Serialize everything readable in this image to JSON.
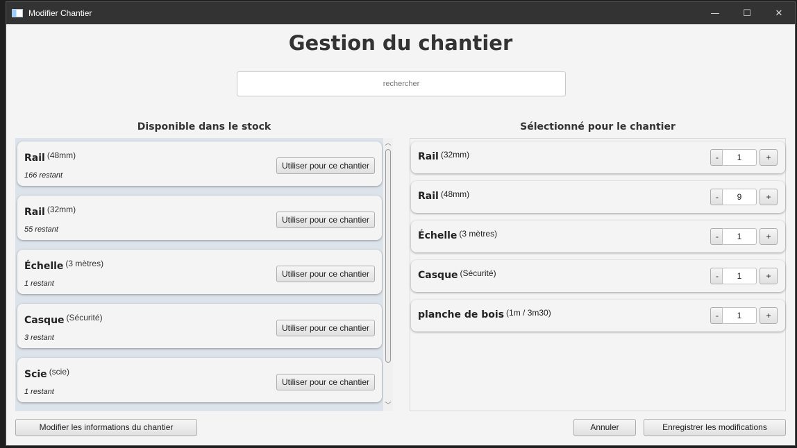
{
  "window": {
    "title": "Modifier Chantier",
    "controls": {
      "minimize": "—",
      "maximize": "☐",
      "close": "✕"
    }
  },
  "page_title": "Gestion du chantier",
  "search": {
    "placeholder": "rechercher",
    "value": ""
  },
  "stock": {
    "heading": "Disponible dans le stock",
    "use_label": "Utiliser pour ce chantier",
    "items": [
      {
        "name": "Rail",
        "detail": "(48mm)",
        "remaining": "166 restant"
      },
      {
        "name": "Rail",
        "detail": "(32mm)",
        "remaining": "55 restant"
      },
      {
        "name": "Échelle",
        "detail": "(3 mètres)",
        "remaining": "1 restant"
      },
      {
        "name": "Casque",
        "detail": "(Sécurité)",
        "remaining": "3 restant"
      },
      {
        "name": "Scie",
        "detail": "(scie)",
        "remaining": "1 restant"
      }
    ]
  },
  "selected": {
    "heading": "Sélectionné pour le chantier",
    "minus_label": "-",
    "plus_label": "+",
    "items": [
      {
        "name": "Rail",
        "detail": "(32mm)",
        "qty": "1"
      },
      {
        "name": "Rail",
        "detail": "(48mm)",
        "qty": "9"
      },
      {
        "name": "Échelle",
        "detail": "(3 mètres)",
        "qty": "1"
      },
      {
        "name": "Casque",
        "detail": "(Sécurité)",
        "qty": "1"
      },
      {
        "name": "planche de bois",
        "detail": "(1m / 3m30)",
        "qty": "1"
      }
    ]
  },
  "footer": {
    "edit_info": "Modifier les informations du chantier",
    "cancel": "Annuler",
    "save": "Enregistrer les modifications"
  }
}
